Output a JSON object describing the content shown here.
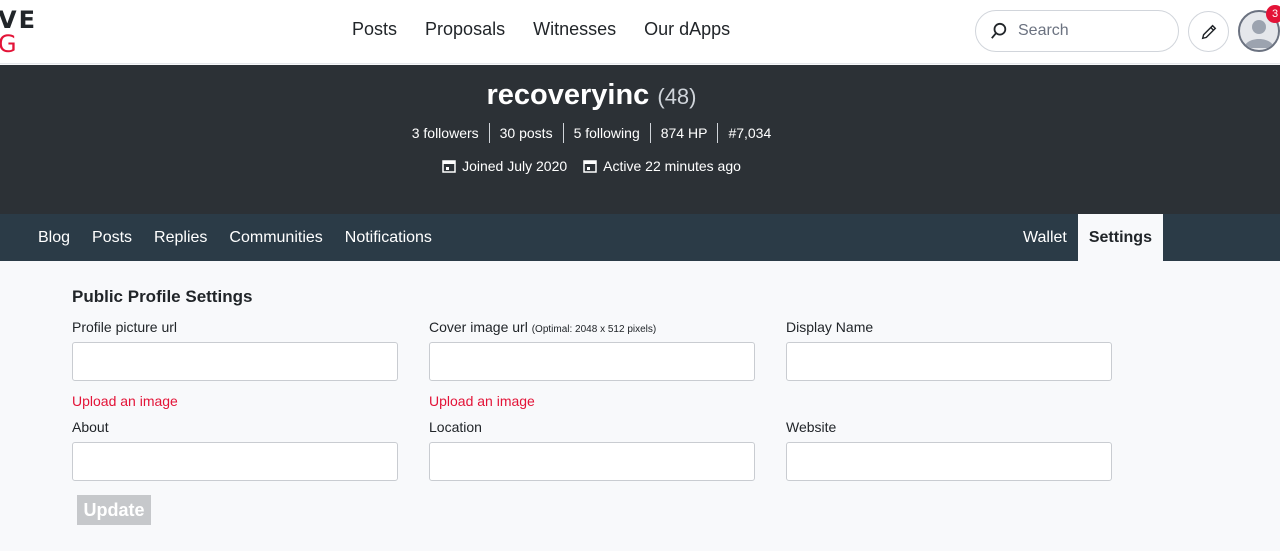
{
  "logo": {
    "line1": "VE",
    "line2": "G"
  },
  "main_nav": {
    "posts": "Posts",
    "proposals": "Proposals",
    "witnesses": "Witnesses",
    "dapps": "Our dApps"
  },
  "search": {
    "placeholder": "Search"
  },
  "notifications": {
    "count": "3"
  },
  "profile": {
    "username": "recoveryinc",
    "reputation": "(48)",
    "stats": [
      "3 followers",
      "30 posts",
      "5 following",
      "874 HP",
      "#7,034"
    ],
    "joined": "Joined July 2020",
    "active": "Active 22 minutes ago"
  },
  "tabs": {
    "left": [
      "Blog",
      "Posts",
      "Replies",
      "Communities",
      "Notifications"
    ],
    "right": [
      "Wallet",
      "Settings"
    ],
    "active": "Settings"
  },
  "settings": {
    "title": "Public Profile Settings",
    "profile_picture_label": "Profile picture url",
    "cover_image_label": "Cover image url",
    "cover_image_hint": "(Optimal: 2048 x 512 pixels)",
    "display_name_label": "Display Name",
    "upload_label": "Upload an image",
    "about_label": "About",
    "location_label": "Location",
    "website_label": "Website",
    "update_label": "Update"
  },
  "colors": {
    "accent": "#e31337",
    "profile_bg": "#2c3136",
    "subnav_bg": "#2b3b47"
  }
}
